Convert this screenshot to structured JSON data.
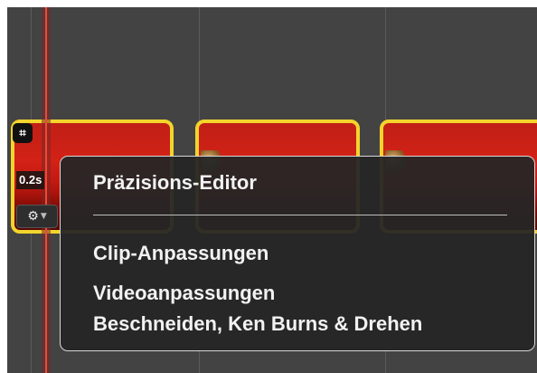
{
  "clip": {
    "crop_icon": "crop-icon",
    "duration": "0.2s",
    "gear_icon": "gear-icon"
  },
  "menu": {
    "items": [
      {
        "label": "Präzisions-Editor"
      },
      {
        "label": "Clip-Anpassungen"
      },
      {
        "label": "Videoanpassungen"
      },
      {
        "label": "Beschneiden, Ken Burns & Drehen"
      }
    ]
  },
  "colors": {
    "timeline_bg": "#434343",
    "playhead": "#ef4a35",
    "clip_border_selected": "#f3d42c",
    "menu_bg": "#262626"
  }
}
